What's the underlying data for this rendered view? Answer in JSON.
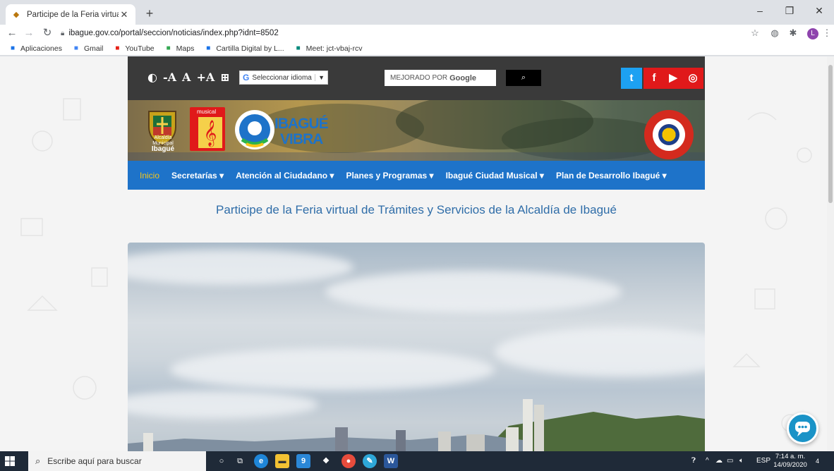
{
  "browser": {
    "tab_title": "Participe de la Feria virtual de Trá",
    "new_tab_symbol": "+",
    "url": "ibague.gov.co/portal/seccion/noticias/index.php?idnt=8502",
    "avatar_letter": "L",
    "bookmarks": [
      {
        "label": "Aplicaciones",
        "icon": "apps-grid-icon",
        "color": "#1a73e8"
      },
      {
        "label": "Gmail",
        "icon": "google-icon",
        "color": "#4285f4"
      },
      {
        "label": "YouTube",
        "icon": "youtube-icon",
        "color": "#e62117"
      },
      {
        "label": "Maps",
        "icon": "maps-icon",
        "color": "#34a853"
      },
      {
        "label": "Cartilla Digital by L...",
        "icon": "globe-icon",
        "color": "#1a73e8"
      },
      {
        "label": "Meet: jct-vbaj-rcv",
        "icon": "meet-icon",
        "color": "#00897b"
      }
    ]
  },
  "site": {
    "accessibility": [
      "◐",
      "-A",
      "A",
      "+A"
    ],
    "language_select": "Seleccionar idioma",
    "search_label": "MEJORADO POR",
    "search_brand": "Google",
    "social": [
      {
        "name": "twitter",
        "symbol": "t",
        "color": "#1da1f2"
      },
      {
        "name": "facebook",
        "symbol": "f",
        "color": "#e0191a"
      },
      {
        "name": "youtube",
        "symbol": "▶",
        "color": "#e0191a"
      },
      {
        "name": "instagram",
        "symbol": "◎",
        "color": "#e0191a"
      }
    ],
    "logo_alcaldia_line1": "Alcaldía Municipal",
    "logo_alcaldia_line2": "Ibagué",
    "logo_musical": "musical",
    "logo_vibra_1": "IBAGUÉ",
    "logo_vibra_2": "VIBRA",
    "menu": [
      {
        "label": "Inicio",
        "active": true,
        "dropdown": false
      },
      {
        "label": "Secretarías ▾",
        "active": false,
        "dropdown": true
      },
      {
        "label": "Atención al Ciudadano ▾",
        "active": false,
        "dropdown": true
      },
      {
        "label": "Planes y Programas ▾",
        "active": false,
        "dropdown": true
      },
      {
        "label": "Ibagué Ciudad Musical ▾",
        "active": false,
        "dropdown": true
      },
      {
        "label": "Plan de Desarrollo Ibagué ▾",
        "active": false,
        "dropdown": true
      }
    ],
    "page_title": "Participe de la Feria virtual de Trámites y Servicios de la Alcaldía de Ibagué",
    "colors": {
      "menu_blue": "#1e73c9",
      "topbar": "#3a3a3a",
      "active_menu": "#f5c518"
    }
  },
  "taskbar": {
    "search_placeholder": "Escribe aquí para buscar",
    "language": "ESP",
    "time": "7:14 a. m.",
    "date": "14/09/2020",
    "notification_count": "4",
    "store_badge": "9"
  }
}
